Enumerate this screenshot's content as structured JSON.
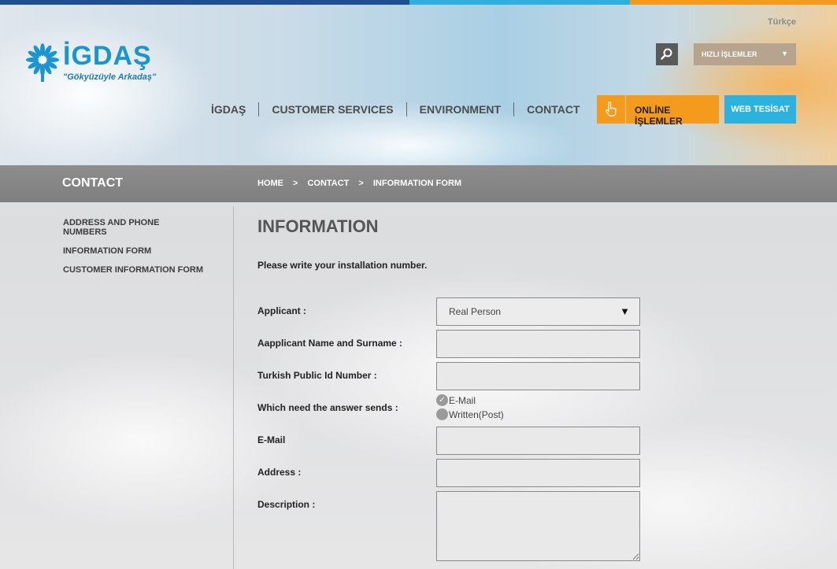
{
  "colors": {
    "topbar": [
      "#1f4f8e",
      "#2fb0dc",
      "#f49a1c"
    ],
    "brand_blue": "#1a95d2",
    "online_orange": "#f49a1c",
    "web_blue": "#2bb2de",
    "band_grey": "#858585"
  },
  "header": {
    "logo_word": "İGDAŞ",
    "logo_slogan": "\"Gökyüzüyle Arkadaş\"",
    "language": "Türkçe",
    "quick_label": "HIZLI İŞLEMLER",
    "quick_arrow": "▼",
    "nav": [
      "İGDAŞ",
      "CUSTOMER SERVICES",
      "ENVIRONMENT",
      "CONTACT"
    ],
    "online_label": "ONLİNE İŞLEMLER",
    "web_label": "WEB TESİSAT"
  },
  "band": {
    "title": "CONTACT",
    "breadcrumb": [
      "HOME",
      "CONTACT",
      "INFORMATION FORM"
    ],
    "separator": ">"
  },
  "sidebar": {
    "items": [
      "ADDRESS AND PHONE NUMBERS",
      "INFORMATION FORM",
      "CUSTOMER INFORMATION FORM"
    ]
  },
  "main": {
    "title": "INFORMATION",
    "intro": "Please write your installation number.",
    "form": {
      "applicant_label": "Applicant :",
      "applicant_value": "Real Person",
      "name_label": "Aapplicant Name and Surname :",
      "id_label": "Turkish Public Id Number :",
      "answer_label": "Which need the answer sends :",
      "answer_options": [
        "E-Mail",
        "Written(Post)"
      ],
      "answer_selected": "E-Mail",
      "email_label": "E-Mail",
      "address_label": "Address :",
      "description_label": "Description :"
    }
  }
}
